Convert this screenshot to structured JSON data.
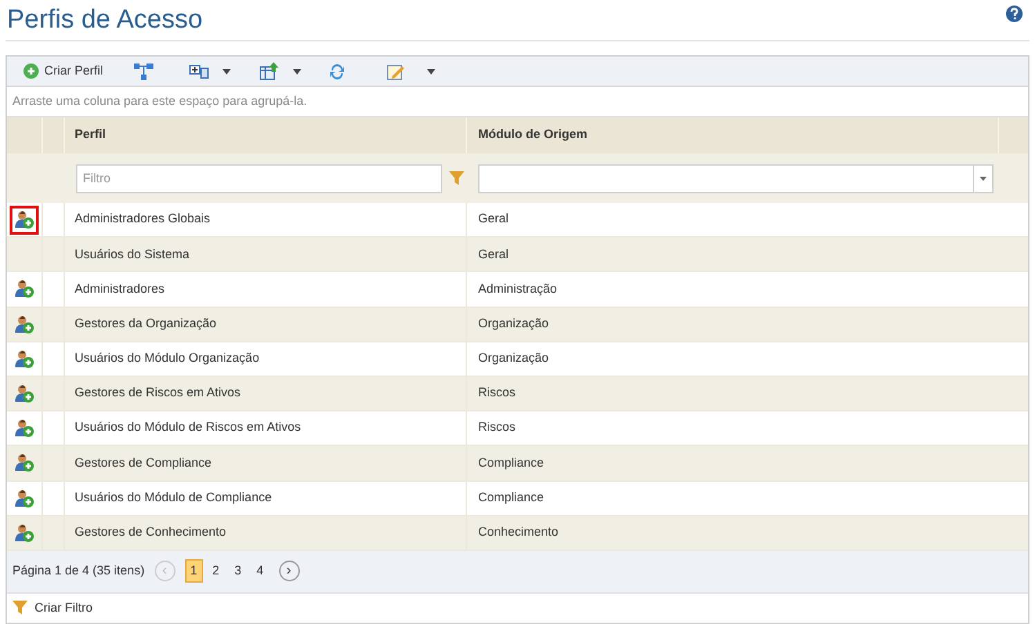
{
  "title": "Perfis de Acesso",
  "toolbar": {
    "create_label": "Criar Perfil"
  },
  "group_panel": "Arraste uma coluna para este espaço para agrupá-la.",
  "table": {
    "columns": [
      "Perfil",
      "Módulo de Origem"
    ],
    "filter": {
      "placeholder": "Filtro"
    },
    "rows": [
      {
        "perfil": "Administradores Globais",
        "modulo": "Geral",
        "has_icon": true,
        "highlighted": true
      },
      {
        "perfil": "Usuários do Sistema",
        "modulo": "Geral",
        "has_icon": false,
        "highlighted": false
      },
      {
        "perfil": "Administradores",
        "modulo": "Administração",
        "has_icon": true,
        "highlighted": false
      },
      {
        "perfil": "Gestores da Organização",
        "modulo": "Organização",
        "has_icon": true,
        "highlighted": false
      },
      {
        "perfil": "Usuários do Módulo Organização",
        "modulo": "Organização",
        "has_icon": true,
        "highlighted": false
      },
      {
        "perfil": "Gestores de Riscos em Ativos",
        "modulo": "Riscos",
        "has_icon": true,
        "highlighted": false
      },
      {
        "perfil": "Usuários do Módulo de Riscos em Ativos",
        "modulo": "Riscos",
        "has_icon": true,
        "highlighted": false
      },
      {
        "perfil": "Gestores de Compliance",
        "modulo": "Compliance",
        "has_icon": true,
        "highlighted": false
      },
      {
        "perfil": "Usuários do Módulo de Compliance",
        "modulo": "Compliance",
        "has_icon": true,
        "highlighted": false
      },
      {
        "perfil": "Gestores de Conhecimento",
        "modulo": "Conhecimento",
        "has_icon": true,
        "highlighted": false
      }
    ]
  },
  "pager": {
    "summary": "Página 1 de 4 (35 itens)",
    "prev": "‹",
    "next": "›",
    "pages": [
      {
        "label": "1",
        "selected": true
      },
      {
        "label": "2",
        "selected": false
      },
      {
        "label": "3",
        "selected": false
      },
      {
        "label": "4",
        "selected": false
      }
    ]
  },
  "footer": {
    "create_filter": "Criar Filtro"
  }
}
